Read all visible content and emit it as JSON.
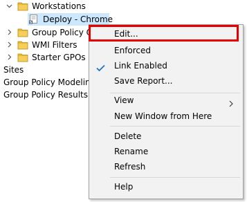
{
  "tree": {
    "items": [
      {
        "label": "Workstations",
        "expanded": true
      },
      {
        "label": "Deploy - Chrome",
        "selected": true
      },
      {
        "label": "Group Policy Ob"
      },
      {
        "label": "WMI Filters"
      },
      {
        "label": "Starter GPOs"
      },
      {
        "label": "Sites"
      },
      {
        "label": "Group Policy Modeling"
      },
      {
        "label": "Group Policy Results"
      }
    ]
  },
  "context_menu": {
    "items": [
      {
        "label": "Edit..."
      },
      {
        "label": "Enforced"
      },
      {
        "label": "Link Enabled",
        "checked": true
      },
      {
        "label": "Save Report..."
      },
      {
        "label": "View",
        "submenu": true
      },
      {
        "label": "New Window from Here"
      },
      {
        "label": "Delete"
      },
      {
        "label": "Rename"
      },
      {
        "label": "Refresh"
      },
      {
        "label": "Help"
      }
    ]
  },
  "colors": {
    "highlight_border": "#e60000",
    "check_blue": "#1a73c8",
    "folder_yellow": "#e8b830",
    "selection_bg": "#cce8ff"
  }
}
